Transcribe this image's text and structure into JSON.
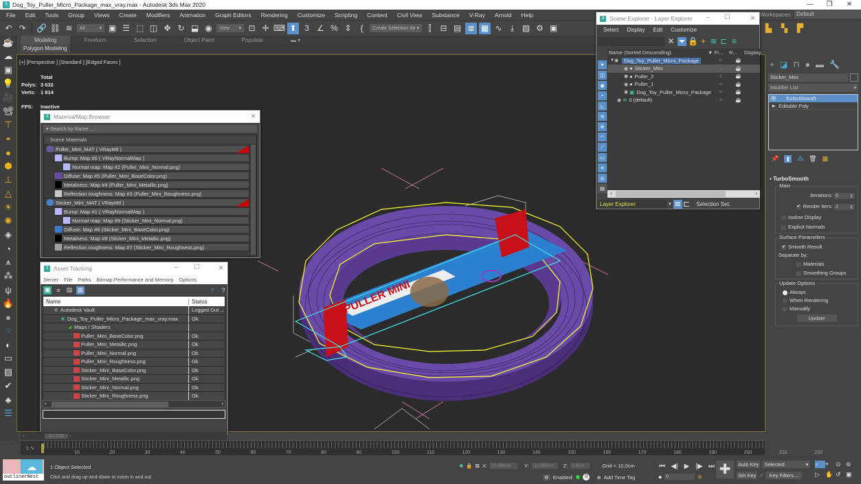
{
  "app": {
    "title": "Dog_Toy_Puller_Micro_Package_max_vray.max - Autodesk 3ds Max 2020",
    "icon": "3"
  },
  "window_controls": {
    "minimize": "—",
    "restore": "❐",
    "close": "✕"
  },
  "menubar": [
    "File",
    "Edit",
    "Tools",
    "Group",
    "Views",
    "Create",
    "Modifiers",
    "Animation",
    "Graph Editors",
    "Rendering",
    "Customize",
    "Scripting",
    "Content",
    "Civil View",
    "Substance",
    "V-Ray",
    "Arnold",
    "Help"
  ],
  "workspaces": {
    "label": "Workspaces:",
    "value": "Default"
  },
  "toolbar": {
    "filter_select": "All",
    "ref_coord": "View",
    "selection_set": "Create Selection Se",
    "snap_value": "3"
  },
  "ribbon": {
    "tabs": [
      "Modeling",
      "Freeform",
      "Selection",
      "Object Paint",
      "Populate"
    ],
    "active": "Modeling",
    "subtab": "Polygon Modeling"
  },
  "viewport": {
    "label": "[+] [Perspective ] [Standard ] [Edged Faces ]",
    "stats": {
      "header": "Total",
      "polys_label": "Polys:",
      "polys": "3 632",
      "verts_label": "Verts:",
      "verts": "1 814",
      "fps_label": "FPS:",
      "fps": "Inactive"
    },
    "sticker_text": "PULLER MINI",
    "colors": {
      "ring": "#5a3a8c",
      "selection": "#ffff33",
      "sticker_outline": "#3fe3e8",
      "sticker_bg": "#2d7fd0",
      "red_band": "#c8101a"
    }
  },
  "material_browser": {
    "title": "Material/Map Browser",
    "search_placeholder": "Search by Name ...",
    "section": "- Scene Materials",
    "items": [
      {
        "label": "Puller_Mini_MAT  ( VRayMtl )",
        "swatch": "#6a5aa0",
        "level": 0
      },
      {
        "label": "Bump: Map #0  ( VRayNormalMap )",
        "swatch": "#b8b8ff",
        "level": 1
      },
      {
        "label": "Normal map: Map #2 (Puller_Mini_Normal.png)",
        "swatch": "#b8b8ff",
        "level": 2
      },
      {
        "label": "Diffuse: Map #5 (Puller_Mini_BaseColor.png)",
        "swatch": "#6a4aa0",
        "level": 1
      },
      {
        "label": "Metalness: Map #4 (Puller_Mini_Metallic.png)",
        "swatch": "#000000",
        "level": 1
      },
      {
        "label": "Reflection roughness: Map #3 (Puller_Mini_Roughness.png)",
        "swatch": "#c8c8c8",
        "level": 1
      },
      {
        "label": "Sticker_Mini_MAT  ( VRayMtl )",
        "swatch": "#4a80c8",
        "level": 0
      },
      {
        "label": "Bump: Map #1  ( VRayNormalMap )",
        "swatch": "#b8b8ff",
        "level": 1
      },
      {
        "label": "Normal map: Map #9 (Sticker_Mini_Normal.png)",
        "swatch": "#b8b8ff",
        "level": 2
      },
      {
        "label": "Diffuse: Map #6 (Sticker_Mini_BaseColor.png)",
        "swatch": "#3a7ad0",
        "level": 1
      },
      {
        "label": "Metalness: Map #8 (Sticker_Mini_Metallic.png)",
        "swatch": "#000000",
        "level": 1
      },
      {
        "label": "Reflection roughness: Map #7 (Sticker_Mini_Roughness.png)",
        "swatch": "#a0a0a0",
        "level": 1
      }
    ]
  },
  "asset_tracking": {
    "title": "Asset Tracking",
    "menu": [
      "Server",
      "File",
      "Paths",
      "Bitmap Performance and Memory",
      "Options"
    ],
    "columns": [
      "Name",
      "Status"
    ],
    "rows": [
      {
        "name": "Autodesk Vault",
        "status": "Logged Out ...",
        "level": 0,
        "icon": "vault"
      },
      {
        "name": "Dog_Toy_Puller_Micro_Package_max_vray.max",
        "status": "Ok",
        "level": 1,
        "icon": "max"
      },
      {
        "name": "Maps / Shaders",
        "status": "",
        "level": 2,
        "icon": "maps"
      },
      {
        "name": "Puller_Mini_BaseColor.png",
        "status": "Ok",
        "level": 3,
        "icon": "png"
      },
      {
        "name": "Puller_Mini_Metallic.png",
        "status": "Ok",
        "level": 3,
        "icon": "png"
      },
      {
        "name": "Puller_Mini_Normal.png",
        "status": "Ok",
        "level": 3,
        "icon": "png"
      },
      {
        "name": "Puller_Mini_Roughness.png",
        "status": "Ok",
        "level": 3,
        "icon": "png"
      },
      {
        "name": "Sticker_Mini_BaseColor.png",
        "status": "Ok",
        "level": 3,
        "icon": "png"
      },
      {
        "name": "Sticker_Mini_Metallic.png",
        "status": "Ok",
        "level": 3,
        "icon": "png"
      },
      {
        "name": "Sticker_Mini_Normal.png",
        "status": "Ok",
        "level": 3,
        "icon": "png"
      },
      {
        "name": "Sticker_Mini_Roughness.png",
        "status": "Ok",
        "level": 3,
        "icon": "png"
      }
    ]
  },
  "scene_explorer": {
    "title": "Scene Explorer - Layer Explorer",
    "menu": [
      "Select",
      "Display",
      "Edit",
      "Customize"
    ],
    "columns": {
      "name": "Name (Sorted Descending)",
      "frozen": "▼ Fr...",
      "render": "R...",
      "display": "Display"
    },
    "rows": [
      {
        "label": "Dog_Toy_Puller_Micro_Package",
        "level": 0,
        "selected": true,
        "type": "layer-root"
      },
      {
        "label": "Sticker_Mini",
        "level": 1,
        "highlighted": true,
        "type": "object"
      },
      {
        "label": "Puller_2",
        "level": 1,
        "type": "object"
      },
      {
        "label": "Puller_1",
        "level": 1,
        "type": "object"
      },
      {
        "label": "Dog_Toy_Puller_Micro_Package",
        "level": 1,
        "type": "group"
      },
      {
        "label": "0 (default)",
        "level": 0,
        "type": "layer"
      }
    ],
    "explorer_select": "Layer Explorer",
    "selection_set_label": "Selection Set:"
  },
  "command_panel": {
    "object_name": "Sticker_Mini",
    "modifier_list": "Modifier List",
    "stack": [
      {
        "label": "TurboSmooth",
        "active": true
      },
      {
        "label": "Editable Poly",
        "active": false
      }
    ],
    "rollout_title": "TurboSmooth",
    "main_group": "Main",
    "iterations_label": "Iterations:",
    "iterations": "0",
    "render_iters_label": "Render Iters:",
    "render_iters": "2",
    "render_iters_checked": true,
    "isoline_label": "Isoline Display",
    "isoline_checked": false,
    "explicit_normals_label": "Explicit Normals",
    "explicit_normals_checked": false,
    "surface_group": "Surface Parameters",
    "smooth_result_label": "Smooth Result",
    "smooth_result_checked": true,
    "separate_by": "Separate by:",
    "materials_label": "Materials",
    "smoothing_groups_label": "Smoothing Groups",
    "update_group": "Update Options",
    "update_options": [
      "Always",
      "When Rendering",
      "Manually"
    ],
    "update_selected": "Always",
    "update_button": "Update"
  },
  "timeline": {
    "frame_indicator": "0 / 225",
    "slider_label": "1 ∿",
    "ticks": [
      "10",
      "20",
      "30",
      "40",
      "50",
      "60",
      "70",
      "80",
      "90",
      "100",
      "110",
      "120",
      "130",
      "140",
      "150",
      "160",
      "170",
      "180",
      "190",
      "200",
      "210",
      "220"
    ]
  },
  "statusbar": {
    "maxscript": "outlinerNest",
    "selection": "1 Object Selected",
    "prompt": "Click and drag up-and-down to zoom in and out",
    "x_label": "X:",
    "x": "10,088cm",
    "y_label": "Y:",
    "y": "-11,882cm",
    "z_label": "Z:",
    "z": "0,0cm",
    "grid": "Grid = 10,0cm",
    "enabled_label": "Enabled:",
    "time_tag": "Add Time Tag",
    "current_frame": "0",
    "auto_key": "Auto Key",
    "set_key": "Set Key",
    "key_mode": "Selected",
    "key_filters": "Key Filters..."
  }
}
